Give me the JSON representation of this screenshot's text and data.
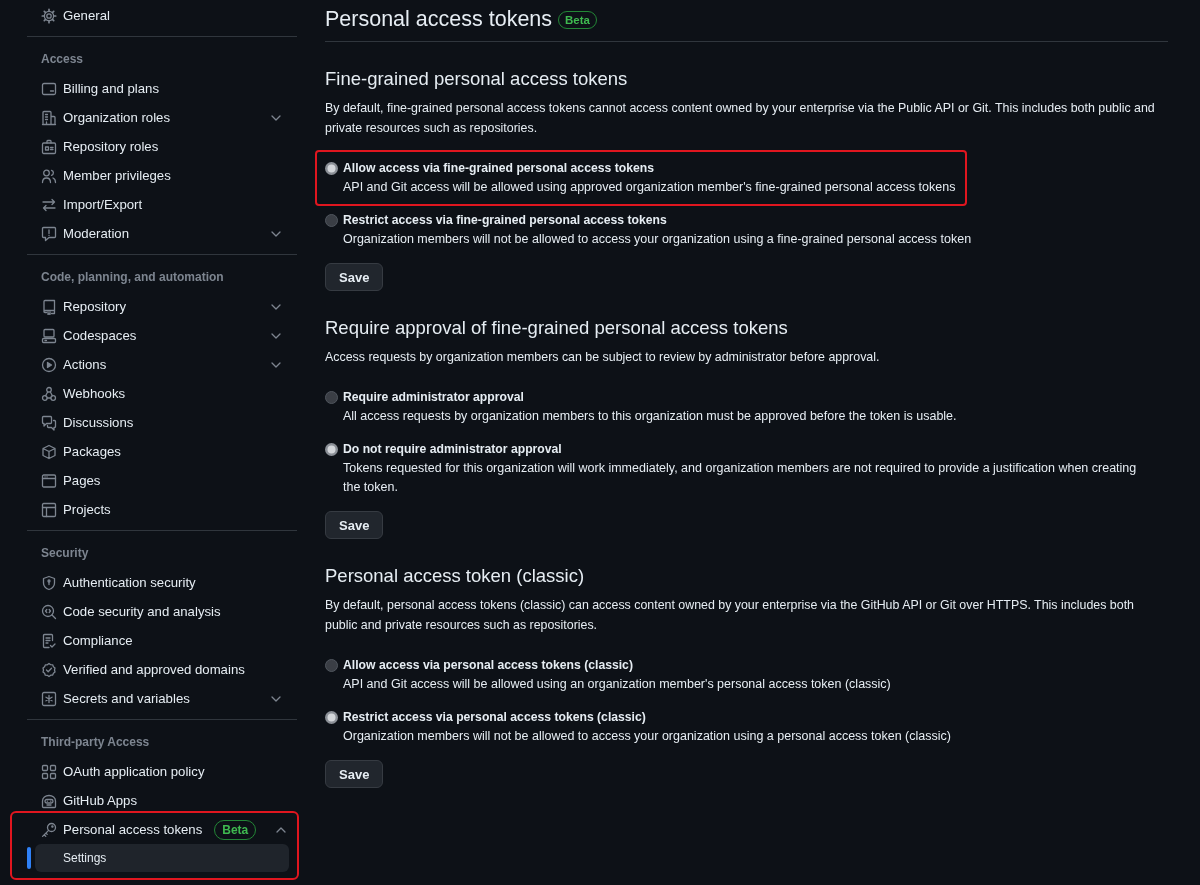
{
  "sidebar": {
    "sections": [
      {
        "items": [
          {
            "label": "General",
            "selected": false,
            "highlighted": false
          }
        ]
      },
      {
        "header": "Access",
        "items": [
          {
            "label": "Billing and plans",
            "selected": false,
            "highlighted": false
          },
          {
            "label": "Organization roles",
            "selected": false,
            "highlighted": false,
            "expanded": false
          },
          {
            "label": "Repository roles",
            "selected": false,
            "highlighted": false
          },
          {
            "label": "Member privileges",
            "selected": false,
            "highlighted": false
          },
          {
            "label": "Import/Export",
            "selected": false,
            "highlighted": false
          },
          {
            "label": "Moderation",
            "selected": false,
            "highlighted": false,
            "expanded": false
          }
        ]
      },
      {
        "header": "Code, planning, and automation",
        "items": [
          {
            "label": "Repository",
            "selected": false,
            "highlighted": false,
            "expanded": false
          },
          {
            "label": "Codespaces",
            "selected": false,
            "highlighted": false,
            "expanded": false
          },
          {
            "label": "Actions",
            "selected": false,
            "highlighted": false,
            "expanded": false
          },
          {
            "label": "Webhooks",
            "selected": false,
            "highlighted": false
          },
          {
            "label": "Discussions",
            "selected": false,
            "highlighted": false
          },
          {
            "label": "Packages",
            "selected": false,
            "highlighted": false
          },
          {
            "label": "Pages",
            "selected": false,
            "highlighted": false
          },
          {
            "label": "Projects",
            "selected": false,
            "highlighted": false
          }
        ]
      },
      {
        "header": "Security",
        "items": [
          {
            "label": "Authentication security",
            "selected": false,
            "highlighted": false
          },
          {
            "label": "Code security and analysis",
            "selected": false,
            "highlighted": false
          },
          {
            "label": "Compliance",
            "selected": false,
            "highlighted": false
          },
          {
            "label": "Verified and approved domains",
            "selected": false,
            "highlighted": false
          },
          {
            "label": "Secrets and variables",
            "selected": false,
            "highlighted": false,
            "expanded": false
          }
        ]
      },
      {
        "header": "Third-party Access",
        "items": [
          {
            "label": "OAuth application policy",
            "selected": false,
            "highlighted": false
          },
          {
            "label": "GitHub Apps",
            "selected": false,
            "highlighted": false
          },
          {
            "label": "Personal access tokens",
            "badge": "Beta",
            "selected": false,
            "highlighted": true,
            "expanded": true,
            "children": [
              {
                "label": "Settings",
                "selected": true
              }
            ]
          }
        ]
      }
    ]
  },
  "page": {
    "title": "Personal access tokens",
    "badge": "Beta"
  },
  "sections": [
    {
      "heading": "Fine-grained personal access tokens",
      "description": "By default, fine-grained personal access tokens cannot access content owned by your enterprise via the Public API or Git. This includes both public and private resources such as repositories.",
      "options": [
        {
          "label": "Allow access via fine-grained personal access tokens",
          "description": "API and Git access will be allowed using approved organization member's fine-grained personal access tokens",
          "selected": true,
          "highlighted": true
        },
        {
          "label": "Restrict access via fine-grained personal access tokens",
          "description": "Organization members will not be allowed to access your organization using a fine-grained personal access token",
          "selected": false,
          "highlighted": false
        }
      ],
      "button": "Save"
    },
    {
      "heading": "Require approval of fine-grained personal access tokens",
      "description": "Access requests by organization members can be subject to review by administrator before approval.",
      "options": [
        {
          "label": "Require administrator approval",
          "description": "All access requests by organization members to this organization must be approved before the token is usable.",
          "selected": false,
          "highlighted": false
        },
        {
          "label": "Do not require administrator approval",
          "description": "Tokens requested for this organization will work immediately, and organization members are not required to provide a justification when creating the token.",
          "selected": true,
          "highlighted": false
        }
      ],
      "button": "Save"
    },
    {
      "heading": "Personal access token (classic)",
      "description": "By default, personal access tokens (classic) can access content owned by your enterprise via the GitHub API or Git over HTTPS. This includes both public and private resources such as repositories.",
      "options": [
        {
          "label": "Allow access via personal access tokens (classic)",
          "description": "API and Git access will be allowed using an organization member's personal access token (classic)",
          "selected": false,
          "highlighted": false
        },
        {
          "label": "Restrict access via personal access tokens (classic)",
          "description": "Organization members will not be allowed to access your organization using a personal access token (classic)",
          "selected": true,
          "highlighted": false
        }
      ],
      "button": "Save"
    }
  ]
}
